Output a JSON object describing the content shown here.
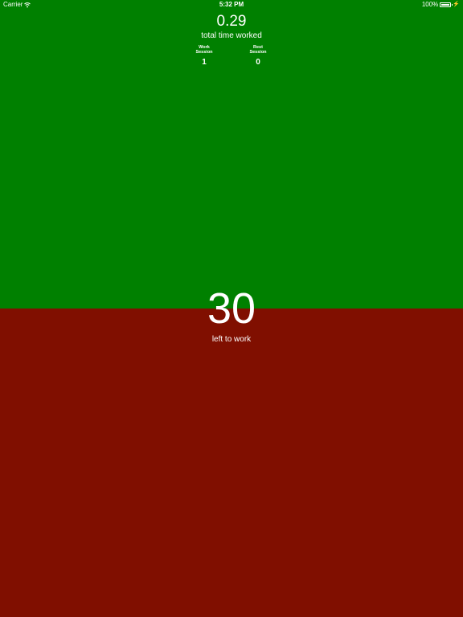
{
  "status_bar": {
    "carrier": "Carrier",
    "time": "5:32 PM",
    "battery": "100%",
    "icons": [
      "wifi-icon",
      "battery-icon",
      "charging-icon"
    ]
  },
  "summary": {
    "total_time": "0.29",
    "total_label": "total time worked",
    "work_session_label": "Work Session",
    "work_session_count": "1",
    "rest_session_label": "Rest Session",
    "rest_session_count": "0"
  },
  "timer": {
    "remaining": "30",
    "label": "left to work"
  },
  "colors": {
    "work_panel": "#008000",
    "rest_panel": "#800f00",
    "text": "#ffffff"
  }
}
